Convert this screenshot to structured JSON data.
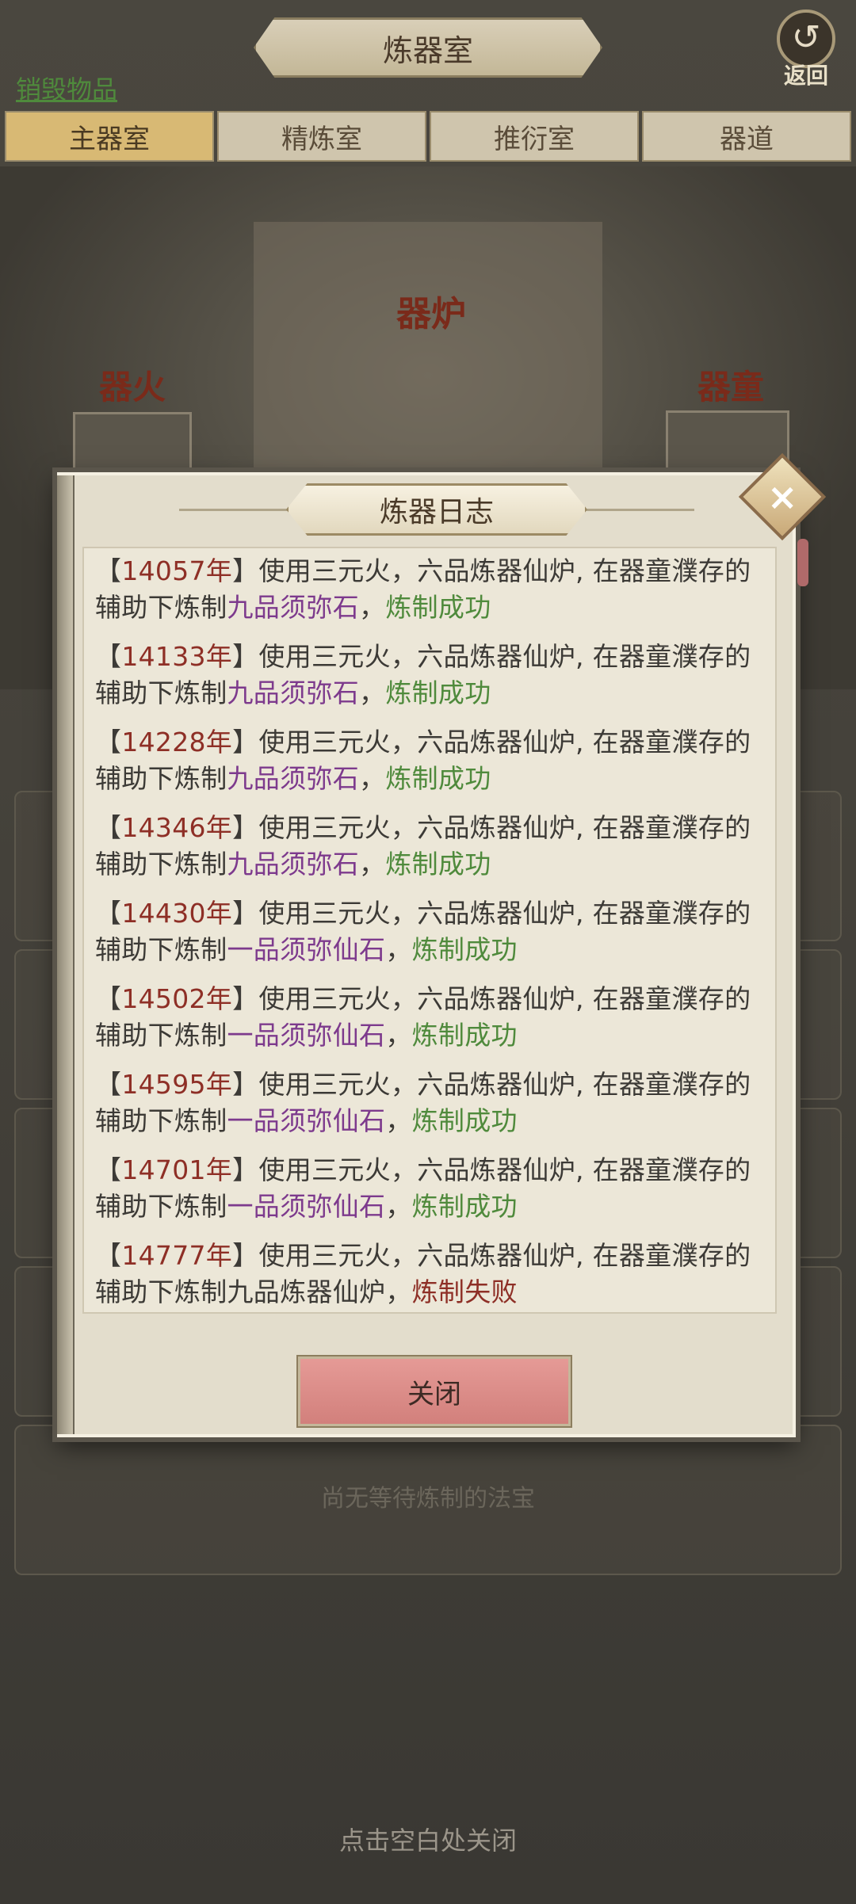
{
  "header": {
    "title": "炼器室",
    "back_label": "返回",
    "back_icon": "↺"
  },
  "destroy_link": "销毁物品",
  "tabs": [
    {
      "label": "主器室",
      "active": true
    },
    {
      "label": "精炼室",
      "active": false
    },
    {
      "label": "推衍室",
      "active": false
    },
    {
      "label": "器道",
      "active": false
    }
  ],
  "stage": {
    "furnace_label": "器炉",
    "fire_label": "器火",
    "boy_label": "器童"
  },
  "queue": {
    "empty_text": "尚无等待炼制的法宝"
  },
  "tap_close": "点击空白处关闭",
  "modal": {
    "title": "炼器日志",
    "close_icon": "×",
    "close_button": "关闭",
    "entries": [
      {
        "year": "14057年",
        "prefix": "使用三元火，六品炼器仙炉, 在器童濮存的辅助下炼制",
        "item": "九品须弥石",
        "item_color": "purple",
        "result": "炼制成功",
        "success": true
      },
      {
        "year": "14133年",
        "prefix": "使用三元火，六品炼器仙炉, 在器童濮存的辅助下炼制",
        "item": "九品须弥石",
        "item_color": "purple",
        "result": "炼制成功",
        "success": true
      },
      {
        "year": "14228年",
        "prefix": "使用三元火，六品炼器仙炉, 在器童濮存的辅助下炼制",
        "item": "九品须弥石",
        "item_color": "purple",
        "result": "炼制成功",
        "success": true
      },
      {
        "year": "14346年",
        "prefix": "使用三元火，六品炼器仙炉, 在器童濮存的辅助下炼制",
        "item": "九品须弥石",
        "item_color": "purple",
        "result": "炼制成功",
        "success": true
      },
      {
        "year": "14430年",
        "prefix": "使用三元火，六品炼器仙炉, 在器童濮存的辅助下炼制",
        "item": "一品须弥仙石",
        "item_color": "purple",
        "result": "炼制成功",
        "success": true
      },
      {
        "year": "14502年",
        "prefix": "使用三元火，六品炼器仙炉, 在器童濮存的辅助下炼制",
        "item": "一品须弥仙石",
        "item_color": "purple",
        "result": "炼制成功",
        "success": true
      },
      {
        "year": "14595年",
        "prefix": "使用三元火，六品炼器仙炉, 在器童濮存的辅助下炼制",
        "item": "一品须弥仙石",
        "item_color": "purple",
        "result": "炼制成功",
        "success": true
      },
      {
        "year": "14701年",
        "prefix": "使用三元火，六品炼器仙炉, 在器童濮存的辅助下炼制",
        "item": "一品须弥仙石",
        "item_color": "purple",
        "result": "炼制成功",
        "success": true
      },
      {
        "year": "14777年",
        "prefix": "使用三元火，六品炼器仙炉, 在器童濮存的辅助下炼制",
        "item": "九品炼器仙炉",
        "item_color": "plain",
        "result": "炼制失败",
        "success": false
      }
    ]
  },
  "colors": {
    "year": "#8e2f26",
    "purple_item": "#7d3a8d",
    "success": "#4f8a3c",
    "fail": "#8e2f26"
  }
}
